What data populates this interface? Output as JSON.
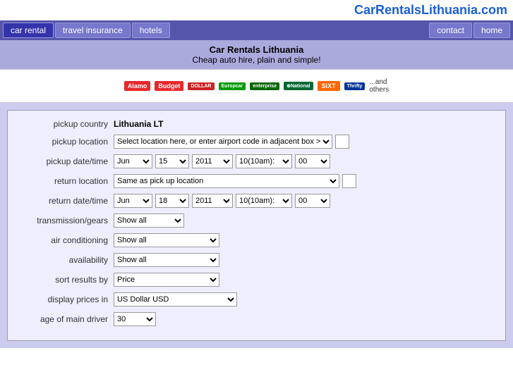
{
  "header": {
    "site_title": "CarRentalsLithuania.com"
  },
  "nav": {
    "left_items": [
      "car rental",
      "travel insurance",
      "hotels"
    ],
    "right_items": [
      "contact",
      "home"
    ],
    "active": "car rental"
  },
  "banner": {
    "title": "Car Rentals Lithuania",
    "subtitle": "Cheap auto hire, plain and simple!"
  },
  "logos": {
    "items": [
      "Alamo",
      "Budget",
      "Dollar",
      "Europcar",
      "enterprise",
      "National",
      "Sixt",
      "Thrifty",
      "...and others"
    ]
  },
  "form": {
    "pickup_country_label": "pickup country",
    "pickup_country_value": "Lithuania LT",
    "pickup_location_label": "pickup location",
    "pickup_location_placeholder": "Select location here, or enter airport code in adjacent box >",
    "pickup_datetime_label": "pickup date/time",
    "pickup_month": "Jun",
    "pickup_day": "15",
    "pickup_year": "2011",
    "pickup_hour": "10(10am):",
    "pickup_min": "00",
    "return_location_label": "return location",
    "return_location_value": "Same as pick up location",
    "return_datetime_label": "return date/time",
    "return_month": "Jun",
    "return_day": "18",
    "return_year": "2011",
    "return_hour": "10(10am):",
    "return_min": "00",
    "transmission_label": "transmission/gears",
    "transmission_value": "Show all",
    "ac_label": "air conditioning",
    "ac_value": "Show all",
    "availability_label": "availability",
    "availability_value": "Show all",
    "sort_label": "sort results by",
    "sort_value": "Price",
    "currency_label": "display prices in",
    "currency_value": "US Dollar USD",
    "age_label": "age of main driver",
    "age_value": "30"
  }
}
